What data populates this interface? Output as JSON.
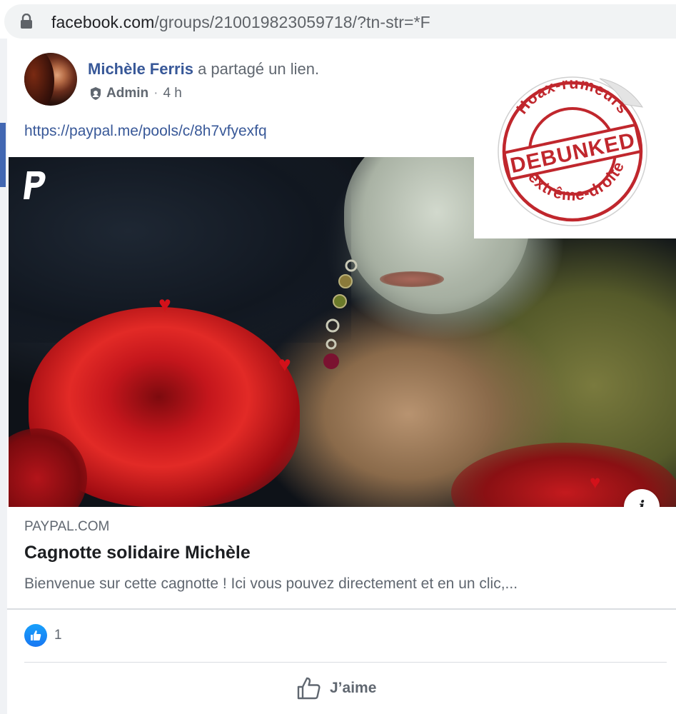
{
  "browser": {
    "url_domain": "facebook.com",
    "url_path": "/groups/210019823059718/?tn-str=*F"
  },
  "post": {
    "author_name": "Michèle Ferris",
    "action_text": "a partagé un lien.",
    "role": "Admin",
    "separator": "·",
    "time": "4 h",
    "link_text": "https://paypal.me/pools/c/8h7vfyexfq"
  },
  "preview": {
    "domain": "PAYPAL.COM",
    "title": "Cagnotte solidaire Michèle",
    "description": "Bienvenue sur cette cagnotte ! Ici vous pouvez directement et en un clic,..."
  },
  "reactions": {
    "count": "1"
  },
  "actions": {
    "like_label": "J’aime"
  },
  "sticker": {
    "top_text": "Hoax-rumeurs",
    "main_text": "DEBUNKED",
    "bottom_text": "d'extrême-droite"
  },
  "info_button": {
    "glyph": "i"
  },
  "icons": {
    "lock": "lock-icon",
    "shield": "admin-shield-icon",
    "paypal": "paypal-logo-icon",
    "like": "like-reaction-icon",
    "thumb": "thumbs-up-icon",
    "info": "info-icon"
  },
  "colors": {
    "link_blue": "#385898",
    "meta_gray": "#606770",
    "like_blue": "#1877f2",
    "stamp_red": "#c0272d"
  }
}
